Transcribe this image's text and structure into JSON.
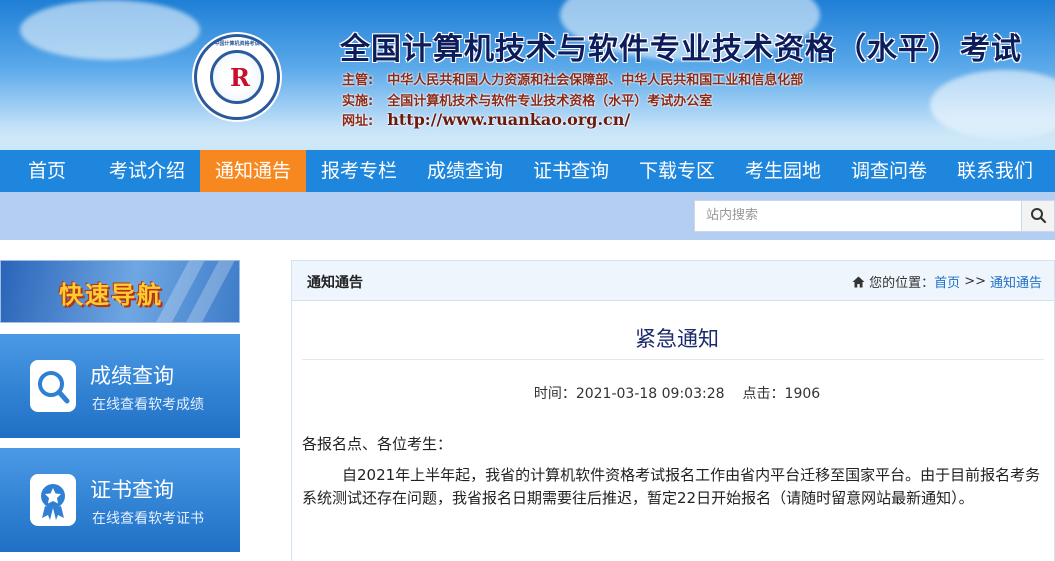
{
  "header": {
    "logo_mark": "R",
    "logo_ring_text": "中国计算机资格考试",
    "title": "全国计算机技术与软件专业技术资格（水平）考试",
    "organizer_label": "主管:",
    "organizer_value": "中华人民共和国人力资源和社会保障部、中华人民共和国工业和信息化部",
    "implementer_label": "实施:",
    "implementer_value": "全国计算机技术与软件专业技术资格（水平）考试办公室",
    "website_label": "网址:",
    "website_value": "http://www.ruankao.org.cn/"
  },
  "nav": {
    "items": [
      "首页",
      "考试介绍",
      "通知通告",
      "报考专栏",
      "成绩查询",
      "证书查询",
      "下载专区",
      "考生园地",
      "调查问卷",
      "联系我们"
    ],
    "active": "通知通告"
  },
  "search": {
    "placeholder": "站内搜索",
    "icon": "search-icon"
  },
  "sidebar": {
    "quick_nav_label": "快速导航",
    "tiles": [
      {
        "title": "成绩查询",
        "subtitle": "在线查看软考成绩",
        "icon": "magnifier-document-icon"
      },
      {
        "title": "证书查询",
        "subtitle": "在线查看软考证书",
        "icon": "certificate-badge-icon"
      }
    ]
  },
  "panel": {
    "title": "通知通告",
    "breadcrumb": {
      "prefix": "您的位置：",
      "home": "首页",
      "separator": ">>",
      "current": "通知通告",
      "icon": "home-icon"
    }
  },
  "article": {
    "title": "紧急通知",
    "time": "时间：2021-03-18 09:03:28",
    "clicks": "点击：1906",
    "greeting": "各报名点、各位考生：",
    "paragraph": "自2021年上半年起，我省的计算机软件资格考试报名工作由省内平台迁移至国家平台。由于目前报名考务系统测试还存在问题，我省报名日期需要往后推迟，暂定22日开始报名（请随时留意网站最新通知）。"
  },
  "colors": {
    "nav_bg": "#1f86dd",
    "nav_active": "#f7881f",
    "search_strip": "#b3cef0",
    "tile_blue": "#2f82d6",
    "title_navy": "#1a2a6c"
  }
}
